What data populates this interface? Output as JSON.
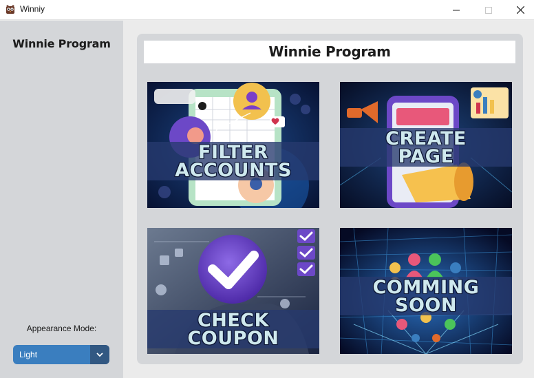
{
  "window": {
    "title": "Winniy",
    "app_icon": "winnie-owl-icon",
    "controls": [
      "minimize-icon",
      "maximize-icon",
      "close-icon"
    ]
  },
  "sidebar": {
    "title": "Winnie Program",
    "appearance_label": "Appearance Mode:",
    "appearance_value": "Light",
    "appearance_color": "#3a7ebf"
  },
  "main": {
    "header_title": "Winnie Program",
    "tiles": [
      {
        "line1": "FILTER",
        "line2": "ACCOUNTS",
        "icon": "social-profile-illustration"
      },
      {
        "line1": "CREATE",
        "line2": "PAGE",
        "icon": "megaphone-phone-illustration"
      },
      {
        "line1": "CHECK",
        "line2": "COUPON",
        "icon": "checkmark-illustration"
      },
      {
        "line1": "COMMING",
        "line2": "SOON",
        "icon": "network-people-illustration"
      }
    ]
  }
}
